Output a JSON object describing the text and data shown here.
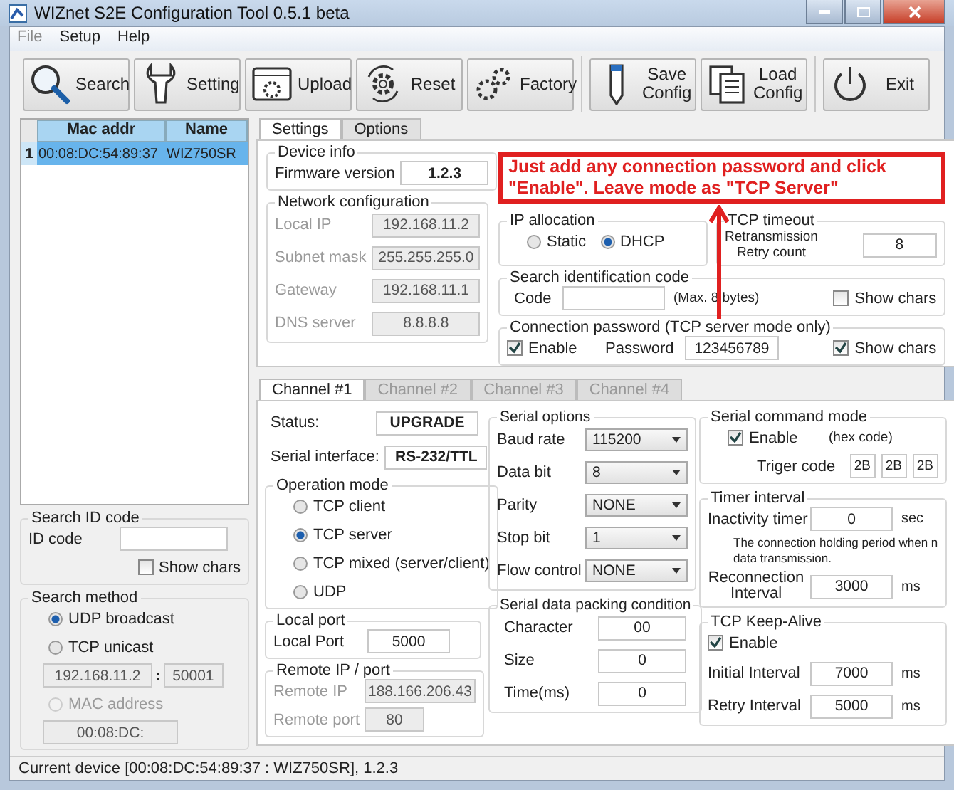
{
  "window": {
    "title": "WIZnet S2E Configuration Tool 0.5.1 beta"
  },
  "menu": [
    {
      "label": "File",
      "disabled": true
    },
    {
      "label": "Setup",
      "disabled": false
    },
    {
      "label": "Help",
      "disabled": false
    }
  ],
  "toolbar": [
    {
      "kind": "search",
      "lines": [
        "Search"
      ]
    },
    {
      "kind": "setting",
      "lines": [
        "Setting"
      ]
    },
    {
      "kind": "upload",
      "lines": [
        "Upload"
      ]
    },
    {
      "kind": "reset",
      "lines": [
        "Reset"
      ]
    },
    {
      "kind": "factory",
      "lines": [
        "Factory"
      ]
    },
    {
      "kind": "save",
      "lines": [
        "Save",
        "Config"
      ]
    },
    {
      "kind": "load",
      "lines": [
        "Load",
        "Config"
      ]
    },
    {
      "kind": "exit",
      "lines": [
        "Exit"
      ]
    }
  ],
  "devices": {
    "columns": [
      "Mac addr",
      "Name"
    ],
    "rows": [
      {
        "index": "1",
        "mac": "00:08:DC:54:89:37",
        "name": "WIZ750SR",
        "selected": true
      }
    ]
  },
  "search_id": {
    "title": "Search ID code",
    "label": "ID code",
    "show_chars": {
      "label": "Show chars",
      "checked": false
    }
  },
  "search_method": {
    "title": "Search method",
    "udp": {
      "label": "UDP broadcast",
      "selected": true
    },
    "tcp": {
      "label": "TCP unicast",
      "selected": false
    },
    "ip": "192.168.11.2",
    "separator": ":",
    "port": "50001",
    "mac": {
      "label": "MAC address",
      "selected": false,
      "disabled": true
    },
    "mac_value": "00:08:DC:"
  },
  "settings_tabs": [
    {
      "label": "Settings",
      "selected": true
    },
    {
      "label": "Options",
      "selected": false
    }
  ],
  "device_info": {
    "title": "Device info",
    "label": "Firmware version",
    "value": "1.2.3"
  },
  "network": {
    "title": "Network configuration",
    "fields": [
      {
        "label": "Local IP",
        "value": "192.168.11.2",
        "disabled": true
      },
      {
        "label": "Subnet mask",
        "value": "255.255.255.0",
        "disabled": true
      },
      {
        "label": "Gateway",
        "value": "192.168.11.1",
        "disabled": true
      },
      {
        "label": "DNS server",
        "value": "8.8.8.8",
        "disabled": true
      }
    ]
  },
  "annotation": {
    "text": "Just add any connection password and click \"Enable\". Leave mode as \"TCP Server\""
  },
  "ip_allocation": {
    "title": "IP allocation",
    "options": [
      {
        "label": "Static",
        "selected": false
      },
      {
        "label": "DHCP",
        "selected": true
      }
    ]
  },
  "tcp_timeout": {
    "title": "TCP timeout",
    "label": [
      "Retransmission",
      "Retry count"
    ],
    "value": "8"
  },
  "search_code": {
    "title": "Search identification code",
    "label": "Code",
    "hint": "(Max. 8 bytes)",
    "show_chars": {
      "label": "Show chars",
      "checked": false
    }
  },
  "conn_password": {
    "title": "Connection password (TCP server mode only)",
    "enable": {
      "label": "Enable",
      "checked": true
    },
    "label": "Password",
    "value": "123456789",
    "show_chars": {
      "label": "Show chars",
      "checked": true
    }
  },
  "channel_tabs": [
    {
      "label": "Channel #1",
      "selected": true
    },
    {
      "label": "Channel #2",
      "selected": false
    },
    {
      "label": "Channel #3",
      "selected": false
    },
    {
      "label": "Channel #4",
      "selected": false
    }
  ],
  "channel": {
    "status_label": "Status:",
    "status": "UPGRADE",
    "interface_label": "Serial interface:",
    "interface": "RS-232/TTL"
  },
  "op_mode": {
    "title": "Operation mode",
    "options": [
      {
        "label": "TCP client",
        "selected": false
      },
      {
        "label": "TCP server",
        "selected": true
      },
      {
        "label": "TCP mixed (server/client)",
        "selected": false
      },
      {
        "label": "UDP",
        "selected": false
      }
    ]
  },
  "local_port": {
    "title": "Local port",
    "label": "Local Port",
    "value": "5000"
  },
  "remote": {
    "title": "Remote IP / port",
    "fields": [
      {
        "label": "Remote IP",
        "value": "188.166.206.43",
        "disabled": true
      },
      {
        "label": "Remote port",
        "value": "80",
        "disabled": true
      }
    ]
  },
  "serial_options": {
    "title": "Serial options",
    "fields": [
      {
        "label": "Baud rate",
        "value": "115200"
      },
      {
        "label": "Data bit",
        "value": "8"
      },
      {
        "label": "Parity",
        "value": "NONE"
      },
      {
        "label": "Stop bit",
        "value": "1"
      },
      {
        "label": "Flow control",
        "value": "NONE"
      }
    ]
  },
  "packing": {
    "title": "Serial data packing condition",
    "fields": [
      {
        "label": "Character",
        "value": "00"
      },
      {
        "label": "Size",
        "value": "0"
      },
      {
        "label": "Time(ms)",
        "value": "0"
      }
    ]
  },
  "serial_cmd": {
    "title": "Serial command mode",
    "enable": {
      "label": "Enable",
      "checked": true
    },
    "hint": "(hex code)",
    "trigger_label": "Triger code",
    "codes": [
      "2B",
      "2B",
      "2B"
    ]
  },
  "timer": {
    "title": "Timer interval",
    "inactivity_label": "Inactivity timer",
    "inactivity": "0",
    "inactivity_unit": "sec",
    "note": [
      "The connection holding period when n",
      "data transmission."
    ],
    "reconnect_label": [
      "Reconnection",
      "Interval"
    ],
    "reconnect": "3000",
    "reconnect_unit": "ms"
  },
  "keepalive": {
    "title": "TCP Keep-Alive",
    "enable": {
      "label": "Enable",
      "checked": true
    },
    "fields": [
      {
        "label": "Initial Interval",
        "value": "7000",
        "unit": "ms"
      },
      {
        "label": "Retry Interval",
        "value": "5000",
        "unit": "ms"
      }
    ]
  },
  "status_bar": {
    "text": "Current device [00:08:DC:54:89:37 : WIZ750SR], 1.2.3"
  }
}
